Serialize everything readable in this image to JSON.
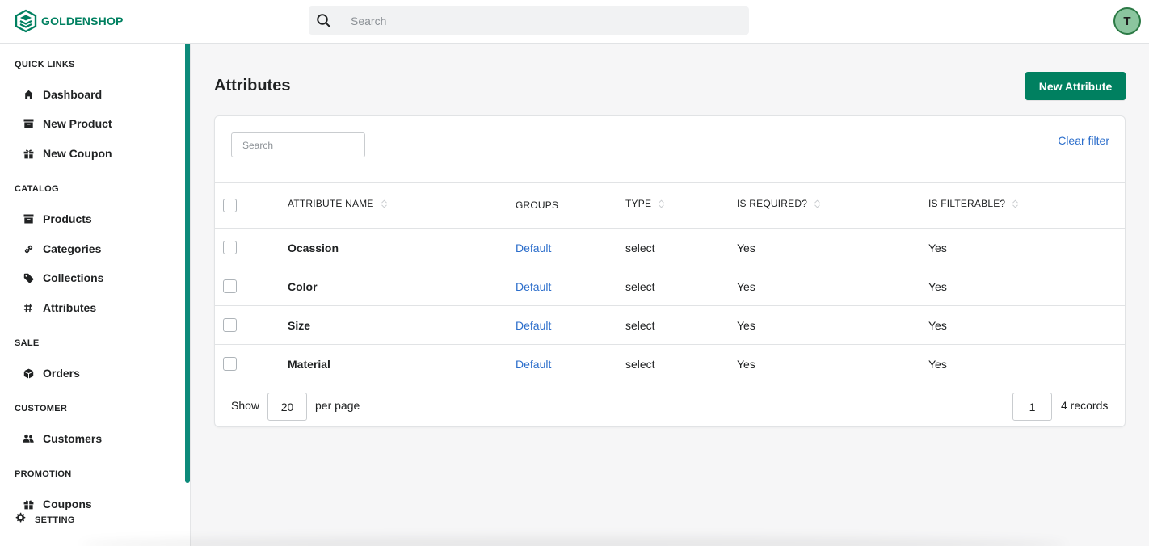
{
  "brand": {
    "name": "GOLDENSHOP",
    "color": "#008060"
  },
  "header": {
    "search_placeholder": "Search",
    "avatar_initial": "T"
  },
  "sidebar": {
    "sections": [
      {
        "title": "QUICK LINKS",
        "items": [
          {
            "label": "Dashboard",
            "icon": "home-icon"
          },
          {
            "label": "New Product",
            "icon": "archive-icon"
          },
          {
            "label": "New Coupon",
            "icon": "gift-icon"
          }
        ]
      },
      {
        "title": "CATALOG",
        "items": [
          {
            "label": "Products",
            "icon": "archive-icon"
          },
          {
            "label": "Categories",
            "icon": "link-icon"
          },
          {
            "label": "Collections",
            "icon": "tag-icon"
          },
          {
            "label": "Attributes",
            "icon": "hash-icon"
          }
        ]
      },
      {
        "title": "SALE",
        "items": [
          {
            "label": "Orders",
            "icon": "box-icon"
          }
        ]
      },
      {
        "title": "CUSTOMER",
        "items": [
          {
            "label": "Customers",
            "icon": "users-icon"
          }
        ]
      },
      {
        "title": "PROMOTION",
        "items": [
          {
            "label": "Coupons",
            "icon": "gift-icon"
          }
        ]
      }
    ],
    "setting_label": "SETTING",
    "accent_color": "#0d8a7a"
  },
  "main": {
    "title": "Attributes",
    "new_button_label": "New Attribute",
    "filter_placeholder": "Search",
    "clear_filter_label": "Clear filter",
    "table": {
      "columns": [
        "ATTRIBUTE NAME",
        "GROUPS",
        "TYPE",
        "IS REQUIRED?",
        "IS FILTERABLE?"
      ],
      "rows": [
        {
          "name": "Ocassion",
          "group": "Default",
          "type": "select",
          "required": "Yes",
          "filterable": "Yes"
        },
        {
          "name": "Color",
          "group": "Default",
          "type": "select",
          "required": "Yes",
          "filterable": "Yes"
        },
        {
          "name": "Size",
          "group": "Default",
          "type": "select",
          "required": "Yes",
          "filterable": "Yes"
        },
        {
          "name": "Material",
          "group": "Default",
          "type": "select",
          "required": "Yes",
          "filterable": "Yes"
        }
      ]
    },
    "footer": {
      "show_label": "Show",
      "per_page_value": "20",
      "per_page_label": "per page",
      "page_value": "1",
      "records_label": "4 records"
    }
  },
  "colors": {
    "primary": "#008060",
    "link": "#2c6ecb"
  }
}
